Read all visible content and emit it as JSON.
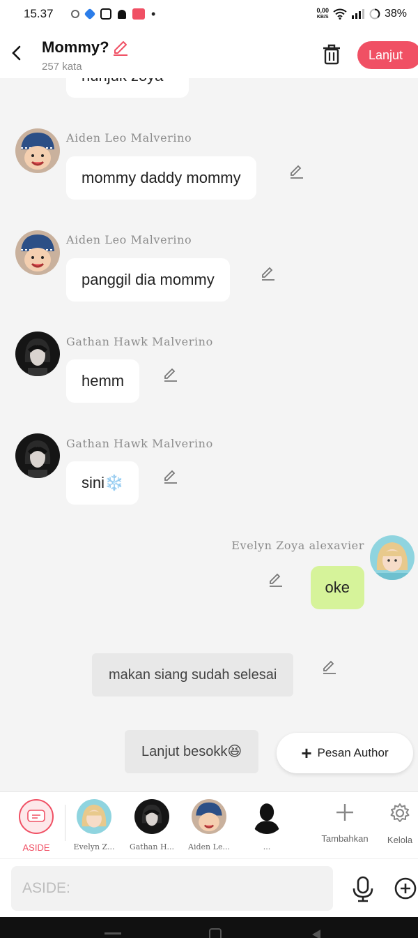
{
  "status_bar": {
    "time": "15.37",
    "net_speed": "0,00",
    "net_unit": "KB/S",
    "battery": "38%",
    "icons": [
      "network-icon",
      "app-icon",
      "instagram-icon",
      "bell-icon",
      "app-badge-icon",
      "dot-icon",
      "wifi-icon",
      "signal-icon",
      "battery-icon"
    ]
  },
  "header": {
    "title": "Mommy?",
    "word_count": "257 kata",
    "next_label": "Lanjut",
    "accent": "#f05064"
  },
  "chat": {
    "partial_message": "nunjuk zoya",
    "messages": [
      {
        "sender": "Aiden Leo Malverino",
        "text": "mommy daddy mommy"
      },
      {
        "sender": "Aiden Leo Malverino",
        "text": "panggil dia mommy"
      },
      {
        "sender": "Gathan Hawk Malverino",
        "text": "hemm"
      },
      {
        "sender": "Gathan Hawk Malverino",
        "text": "sini❄️"
      },
      {
        "sender": "Evelyn Zoya alexavier",
        "text": "oke"
      }
    ],
    "narrations": [
      "makan siang sudah selesai",
      "Lanjut besokk😆"
    ],
    "author_button": "Pesan Author"
  },
  "characters": [
    {
      "name": "ASIDE"
    },
    {
      "name": "Evelyn Z..."
    },
    {
      "name": "Gathan H..."
    },
    {
      "name": "Aiden Le..."
    },
    {
      "name": "..."
    }
  ],
  "tools": {
    "add_label": "Tambahkan",
    "manage_label": "Kelola"
  },
  "input": {
    "placeholder": "ASIDE:"
  },
  "colors": {
    "right_bubble": "#d6f39a",
    "narration_bg": "#e8e8e8",
    "accent": "#f05064"
  }
}
